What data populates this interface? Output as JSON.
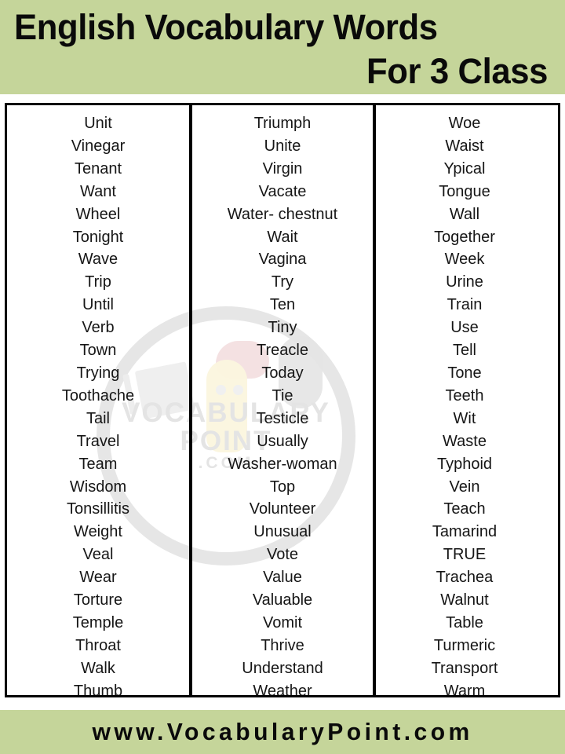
{
  "header": {
    "line1": "English Vocabulary Words",
    "line2": "For 3 Class",
    "background_color": "#c5d59a",
    "text_color": "#0a0a0a"
  },
  "watermark": {
    "line1": "VOCABULARY",
    "line2": "POINT",
    "line3": ".COM",
    "color": "#e4e4e4"
  },
  "footer": {
    "text": "www.VocabularyPoint.com",
    "background_color": "#c5d59a",
    "text_color": "#0a0a0a"
  },
  "table": {
    "border_color": "#000000",
    "columns": [
      {
        "id": "column-1",
        "words": [
          "Unit",
          "Vinegar",
          "Tenant",
          "Want",
          "Wheel",
          "Tonight",
          "Wave",
          "Trip",
          "Until",
          "Verb",
          "Town",
          "Trying",
          "Toothache",
          "Tail",
          "Travel",
          "Team",
          "Wisdom",
          "Tonsillitis",
          "Weight",
          "Veal",
          "Wear",
          "Torture",
          "Temple",
          "Throat",
          "Walk",
          "Thumb"
        ]
      },
      {
        "id": "column-2",
        "words": [
          "Triumph",
          "Unite",
          "Virgin",
          "Vacate",
          "Water- chestnut",
          "Wait",
          "Vagina",
          "Try",
          "Ten",
          "Tiny",
          "Treacle",
          "Today",
          "Tie",
          "Testicle",
          "Usually",
          "Washer-woman",
          "Top",
          "Volunteer",
          "Unusual",
          "Vote",
          "Value",
          "Valuable",
          "Vomit",
          "Thrive",
          "Understand",
          "Weather"
        ]
      },
      {
        "id": "column-3",
        "words": [
          "Woe",
          "Waist",
          "Ypical",
          "Tongue",
          "Wall",
          "Together",
          "Week",
          "Urine",
          "Train",
          "Use",
          "Tell",
          "Tone",
          "Teeth",
          "Wit",
          "Waste",
          "Typhoid",
          "Vein",
          "Teach",
          "Tamarind",
          "TRUE",
          "Trachea",
          "Walnut",
          "Table",
          "Turmeric",
          "Transport",
          "Warm"
        ]
      }
    ]
  }
}
